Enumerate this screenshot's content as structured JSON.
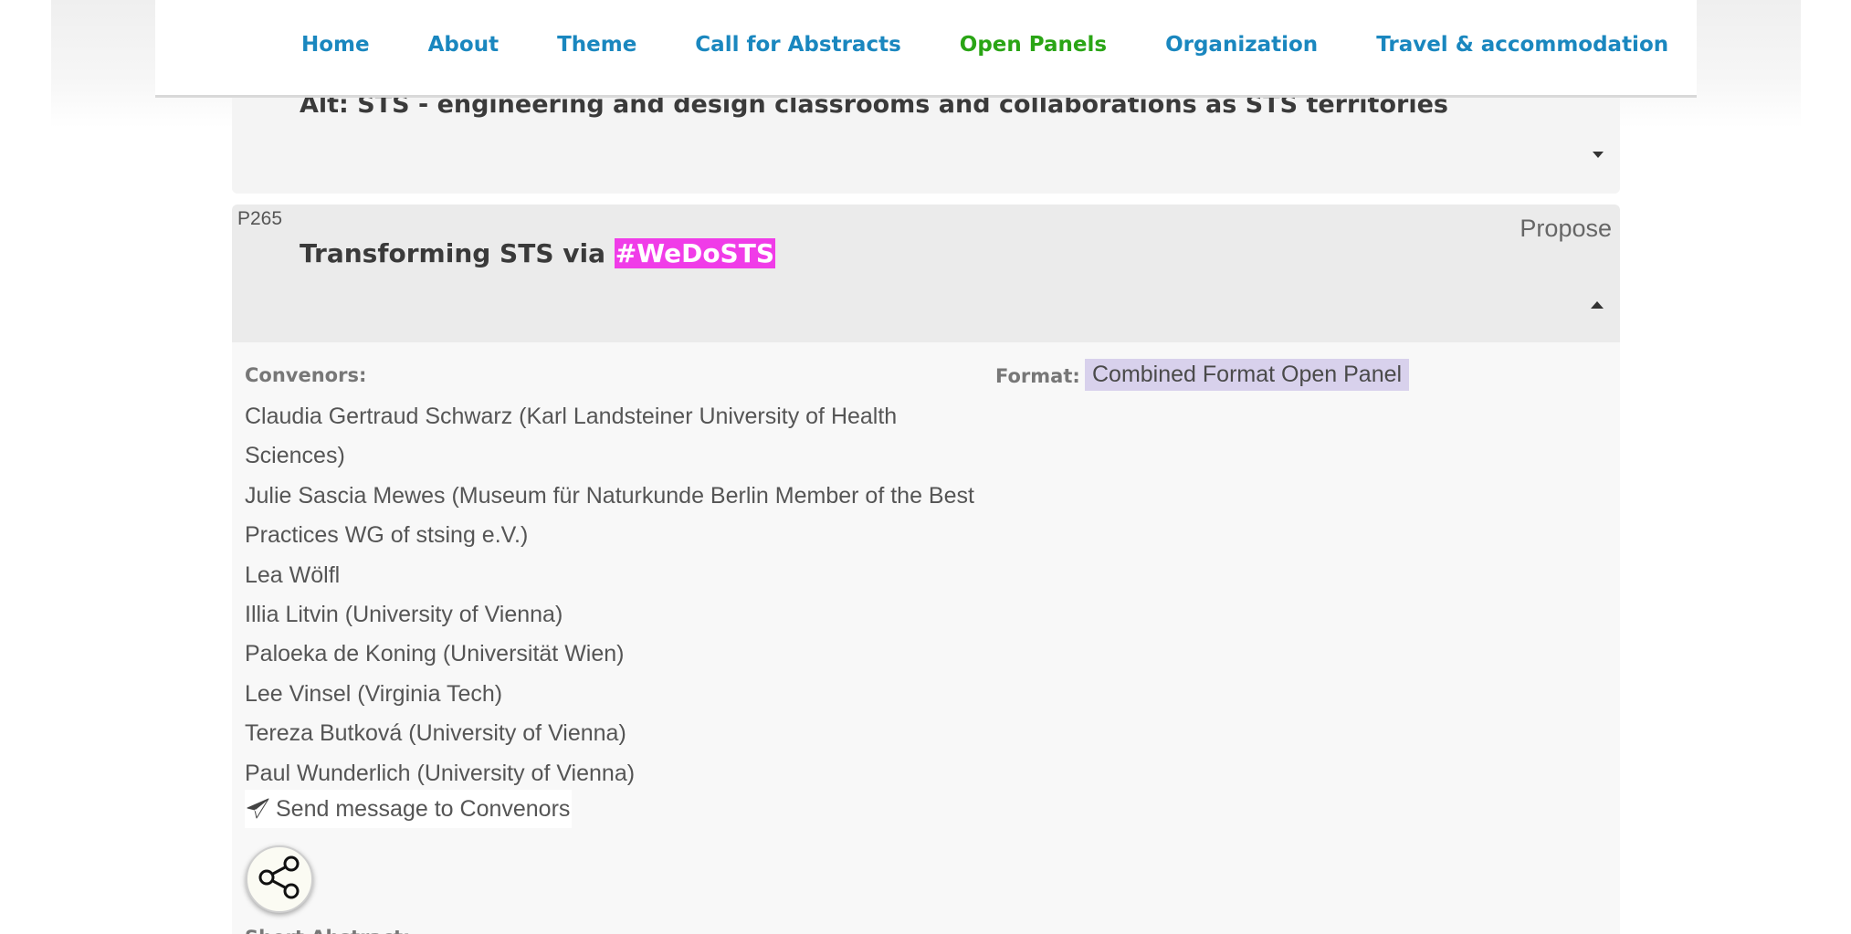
{
  "nav": {
    "items": [
      {
        "label": "Home"
      },
      {
        "label": "About"
      },
      {
        "label": "Theme"
      },
      {
        "label": "Call for Abstracts"
      },
      {
        "label": "Open Panels"
      },
      {
        "label": "Organization"
      },
      {
        "label": "Travel & accommodation"
      }
    ],
    "active": "Open Panels"
  },
  "previous_panel": {
    "title": "Alt: STS - engineering and design classrooms and collaborations as STS territories"
  },
  "panel": {
    "code": "P265",
    "propose_label": "Propose",
    "title_prefix": "Transforming STS via ",
    "title_hashtag": "#WeDoSTS",
    "convenors_label": "Convenors:",
    "convenors": [
      "Claudia Gertraud Schwarz (Karl Landsteiner University of Health Sciences)",
      "Julie Sascia Mewes (Museum für Naturkunde Berlin Member of the Best Practices WG of stsing e.V.)",
      "Lea Wölfl",
      "Illia Litvin (University of Vienna)",
      "Paloeka de Koning (Universität Wien)",
      "Lee Vinsel (Virginia Tech)",
      "Tereza Butková (University of Vienna)",
      "Paul Wunderlich (University of Vienna)"
    ],
    "send_message_label": "Send message to Convenors",
    "format_label": "Format:",
    "format_value": "Combined Format Open Panel",
    "short_abstract_label": "Short Abstract:"
  },
  "colors": {
    "nav_link": "#1a87bf",
    "nav_active": "#2aa515",
    "hashtag_bg": "#f03ce8",
    "format_badge_bg": "#d8d1ec"
  },
  "icons": [
    "send-icon",
    "share-icon",
    "caret-down-icon",
    "caret-up-icon"
  ]
}
